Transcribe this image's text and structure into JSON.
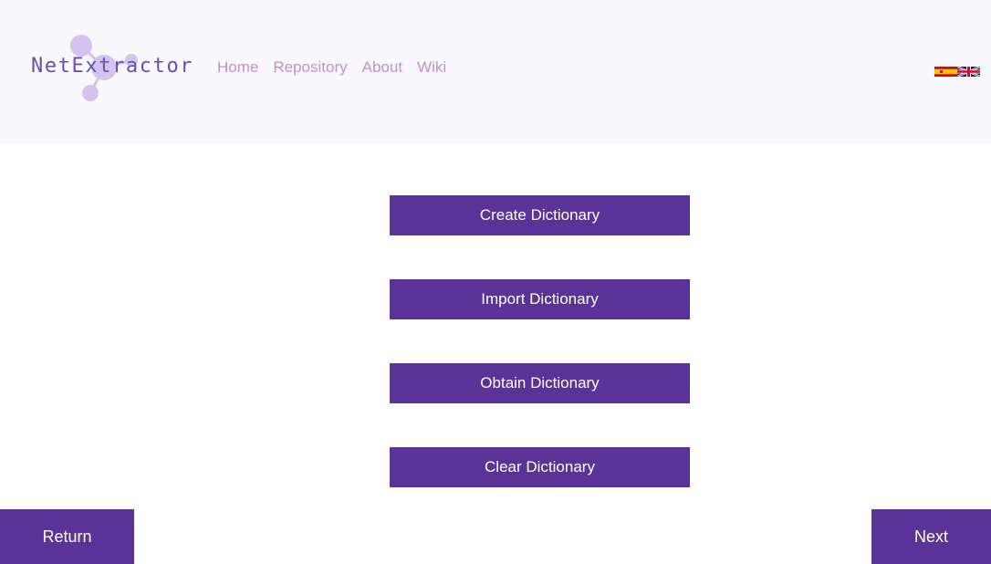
{
  "header": {
    "logo_text": "NetExtractor",
    "nav": [
      "Home",
      "Repository",
      "About",
      "Wiki"
    ],
    "flags": [
      "spanish-flag-icon",
      "english-flag-icon"
    ]
  },
  "main": {
    "buttons": [
      "Create Dictionary",
      "Import Dictionary",
      "Obtain Dictionary",
      "Clear Dictionary"
    ]
  },
  "footer": {
    "return_label": "Return",
    "next_label": "Next"
  },
  "colors": {
    "header_bg": "#f9f8fc",
    "primary": "#5a3298",
    "nav_link": "#c48ed1",
    "logo_text": "#6a4fb0",
    "logo_nodes": "#d5c3ef"
  }
}
